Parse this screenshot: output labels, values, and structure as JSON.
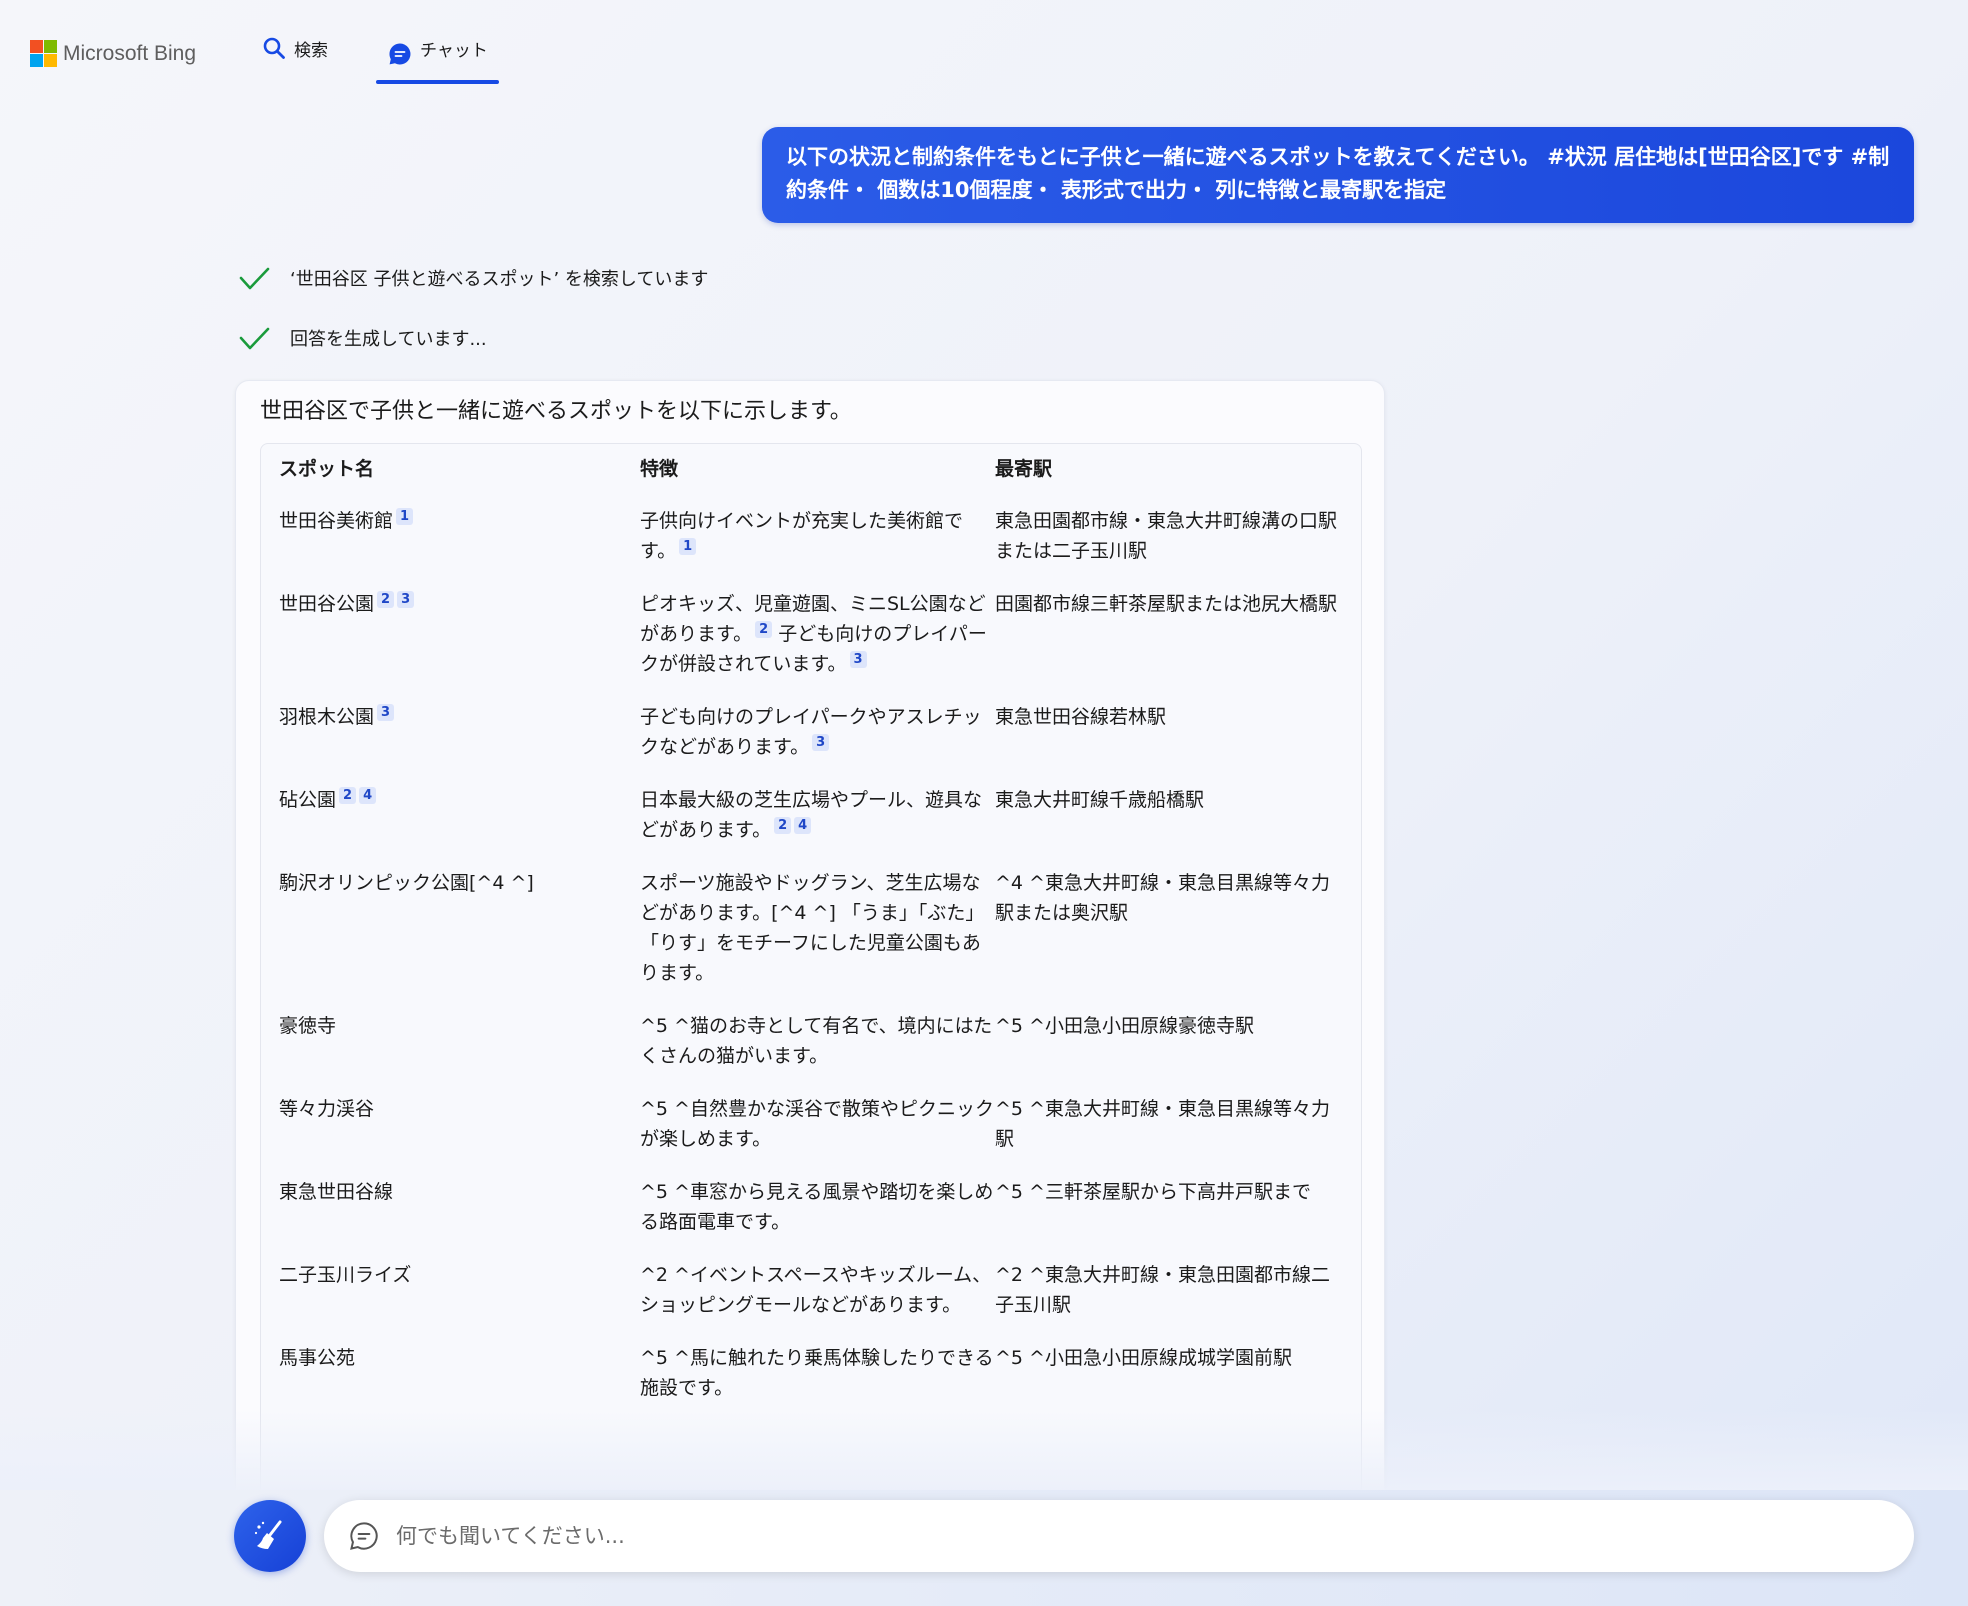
{
  "header": {
    "brand": "Microsoft Bing",
    "tabs": [
      {
        "label": "検索",
        "icon": "search-icon"
      },
      {
        "label": "チャット",
        "icon": "chat-icon",
        "active": true
      }
    ]
  },
  "colors": {
    "accent": "#174ae4",
    "check": "#1a9b3c"
  },
  "user_message": "以下の状況と制約条件をもとに子供と一緒に遊べるスポットを教えてください。 #状況 居住地は[世田谷区]です #制約条件・ 個数は10個程度・ 表形式で出力・ 列に特徴と最寄駅を指定",
  "status": {
    "searching": "‘世田谷区 子供と遊べるスポット’ を検索しています",
    "generating": "回答を生成しています..."
  },
  "answer": {
    "intro": "世田谷区で子供と一緒に遊べるスポットを以下に示します。",
    "columns": [
      "スポット名",
      "特徴",
      "最寄駅"
    ],
    "rows": [
      {
        "name": "世田谷美術館",
        "name_refs": [
          "1"
        ],
        "feature": "子供向けイベントが充実した美術館です。",
        "feature_refs": [
          "1"
        ],
        "station": "東急田園都市線・東急大井町線溝の口駅または二子玉川駅"
      },
      {
        "name": "世田谷公園",
        "name_refs": [
          "2",
          "3"
        ],
        "feature": "ピオキッズ、児童遊園、ミニSL公園などがあります。",
        "feature_refs": [
          "2"
        ],
        "feature2": "子ども向けのプレイパークが併設されています。",
        "feature2_refs": [
          "3"
        ],
        "station": "田園都市線三軒茶屋駅または池尻大橋駅"
      },
      {
        "name": "羽根木公園",
        "name_refs": [
          "3"
        ],
        "feature": "子ども向けのプレイパークやアスレチックなどがあります。",
        "feature_refs": [
          "3"
        ],
        "station": "東急世田谷線若林駅"
      },
      {
        "name": "砧公園",
        "name_refs": [
          "2",
          "4"
        ],
        "feature": "日本最大級の芝生広場やプール、遊具などがあります。",
        "feature_refs": [
          "2",
          "4"
        ],
        "station": "東急大井町線千歳船橋駅"
      },
      {
        "name": "駒沢オリンピック公園[^4 ^]",
        "name_refs": [],
        "feature": "スポーツ施設やドッグラン、芝生広場などがあります。[^4 ^] 「うま」「ぶた」「りす」をモチーフにした児童公園もあります。",
        "feature_refs": [],
        "station": "^4 ^東急大井町線・東急目黒線等々力駅または奥沢駅"
      },
      {
        "name": "豪徳寺",
        "name_refs": [],
        "feature": "^5 ^猫のお寺として有名で、境内にはたくさんの猫がいます。",
        "feature_refs": [],
        "station": "^5 ^小田急小田原線豪徳寺駅"
      },
      {
        "name": "等々力渓谷",
        "name_refs": [],
        "feature": "^5 ^自然豊かな渓谷で散策やピクニックが楽しめます。",
        "feature_refs": [],
        "station": "^5 ^東急大井町線・東急目黒線等々力駅"
      },
      {
        "name": "東急世田谷線",
        "name_refs": [],
        "feature": "^5 ^車窓から見える風景や踏切を楽しめる路面電車です。",
        "feature_refs": [],
        "station": "^5 ^三軒茶屋駅から下高井戸駅まで"
      },
      {
        "name": "二子玉川ライズ",
        "name_refs": [],
        "feature": "^2 ^イベントスペースやキッズルーム、ショッピングモールなどがあります。",
        "feature_refs": [],
        "station": "^2 ^東急大井町線・東急田園都市線二子玉川駅"
      },
      {
        "name": "馬事公苑",
        "name_refs": [],
        "feature": "^5 ^馬に触れたり乗馬体験したりできる施設です。",
        "feature_refs": [],
        "station": "^5 ^小田急小田原線成城学園前駅"
      }
    ]
  },
  "input": {
    "placeholder": "何でも聞いてください..."
  },
  "buttons": {
    "new_topic_icon": "broom-icon"
  }
}
